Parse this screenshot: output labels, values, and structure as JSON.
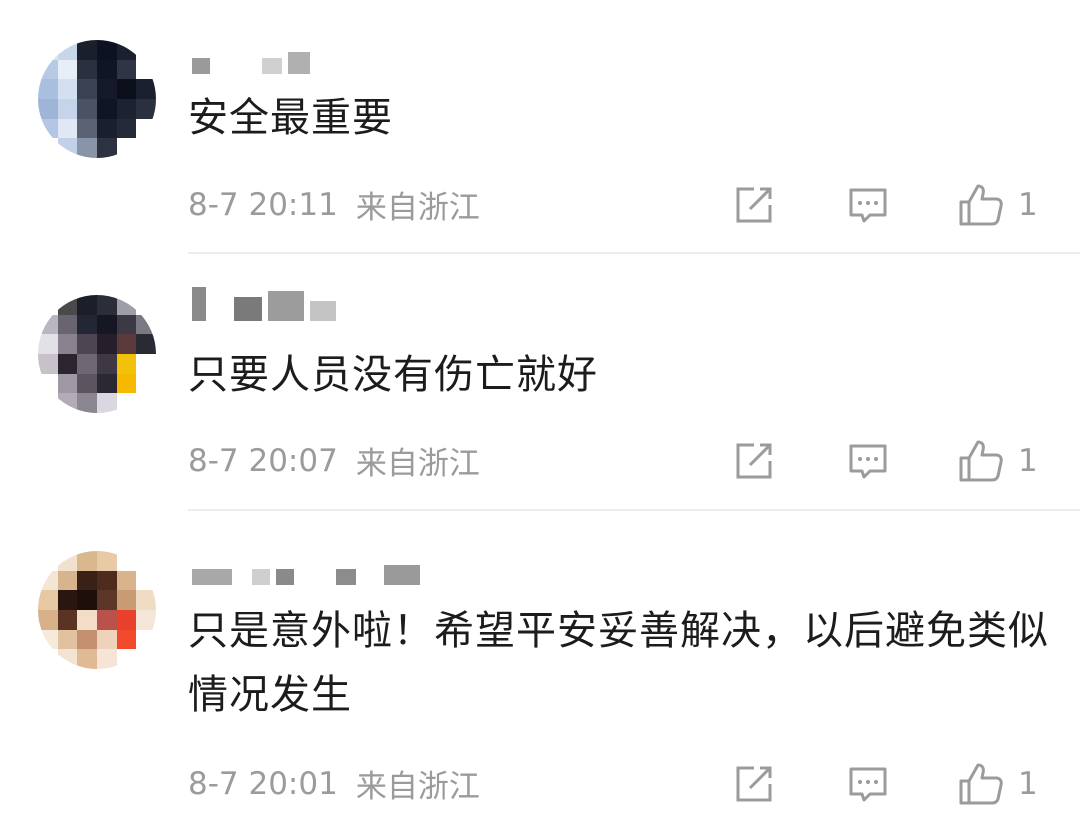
{
  "comments": [
    {
      "text": "安全最重要",
      "time": "8-7 20:11",
      "location": "来自浙江",
      "likes": "1"
    },
    {
      "text": "只要人员没有伤亡就好",
      "time": "8-7 20:07",
      "location": "来自浙江",
      "likes": "1"
    },
    {
      "text": "只是意外啦！希望平安妥善解决，以后避免类似情况发生",
      "time": "8-7 20:01",
      "location": "来自浙江",
      "likes": "1"
    }
  ],
  "icons": {
    "share": "share-icon",
    "reply": "comment-icon",
    "like": "thumbs-up-icon"
  },
  "colors": {
    "text": "#1c1c1c",
    "meta": "#9b9b9b",
    "divider": "#ececec",
    "icon": "#9b9b9b"
  }
}
